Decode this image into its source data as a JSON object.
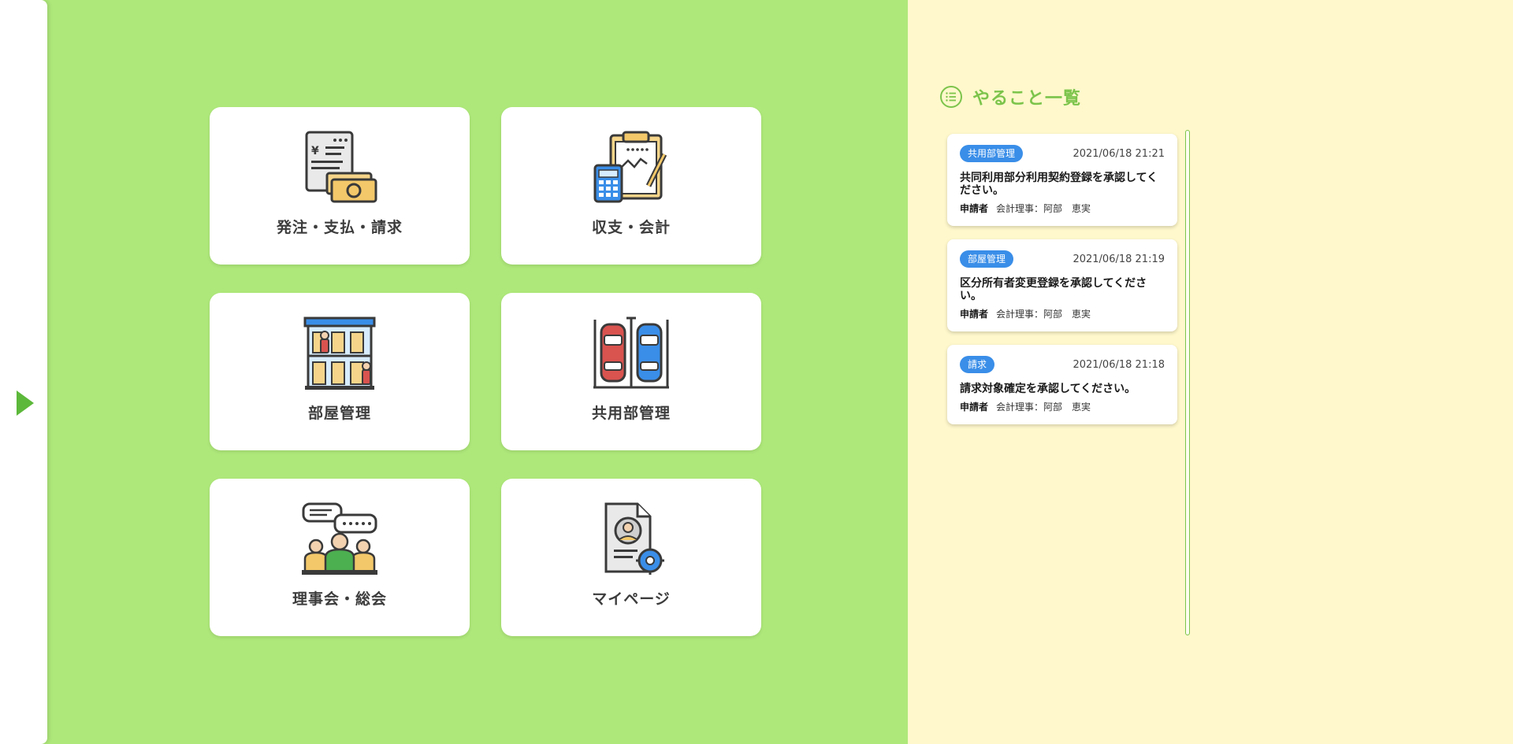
{
  "colors": {
    "main_bg": "#aee87a",
    "panel_bg": "#fff8cc",
    "accent_green": "#7cc44b",
    "tag_blue": "#3a8ee8"
  },
  "sidebar": {
    "toggle_icon": "triangle-right-icon"
  },
  "menu": {
    "orders": {
      "label": "発注・支払・請求",
      "icon": "invoice-cash-icon"
    },
    "accounting": {
      "label": "収支・会計",
      "icon": "clipboard-calculator-icon"
    },
    "rooms": {
      "label": "部屋管理",
      "icon": "apartment-building-icon"
    },
    "common": {
      "label": "共用部管理",
      "icon": "parking-cars-icon"
    },
    "board": {
      "label": "理事会・総会",
      "icon": "meeting-people-icon"
    },
    "mypage": {
      "label": "マイページ",
      "icon": "profile-document-icon"
    }
  },
  "todo": {
    "title": "やること一覧",
    "title_icon": "list-icon",
    "items": [
      {
        "tag": "共用部管理",
        "date": "2021/06/18 21:21",
        "title": "共同利用部分利用契約登録を承認してください。",
        "applicant_label": "申請者",
        "applicant": "会計理事：阿部　恵実"
      },
      {
        "tag": "部屋管理",
        "date": "2021/06/18 21:19",
        "title": "区分所有者変更登録を承認してください。",
        "applicant_label": "申請者",
        "applicant": "会計理事：阿部　恵実"
      },
      {
        "tag": "請求",
        "date": "2021/06/18 21:18",
        "title": "請求対象確定を承認してください。",
        "applicant_label": "申請者",
        "applicant": "会計理事：阿部　恵実"
      }
    ]
  }
}
